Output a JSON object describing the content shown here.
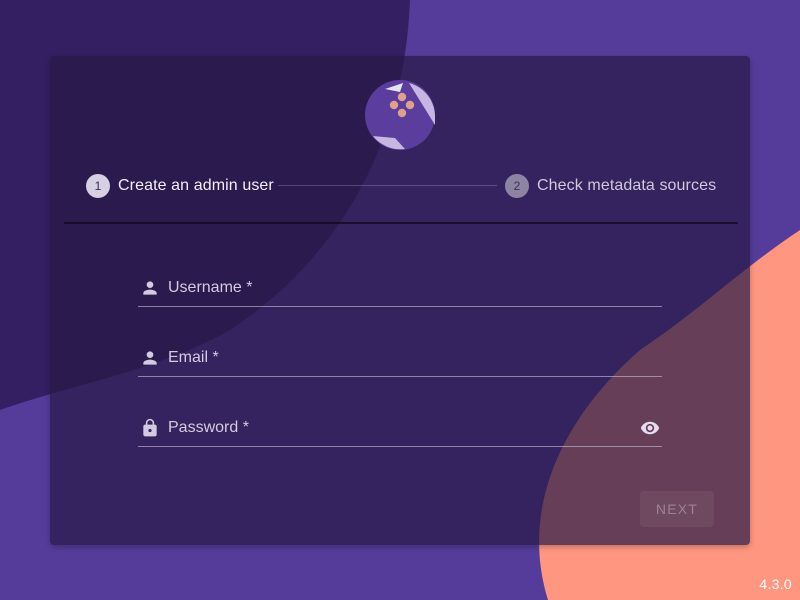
{
  "colors": {
    "background": "#553c9a",
    "dark_blob": "#341f63",
    "accent_blob": "#ff9680",
    "card": "#261846",
    "logo_dots": "#e0a08c"
  },
  "logo": {
    "icon": "app-logo-icon"
  },
  "stepper": {
    "steps": [
      {
        "number": "1",
        "label": "Create an admin user",
        "active": true
      },
      {
        "number": "2",
        "label": "Check metadata sources",
        "active": false
      }
    ]
  },
  "form": {
    "username": {
      "placeholder": "Username *",
      "value": "",
      "icon": "person-icon"
    },
    "email": {
      "placeholder": "Email *",
      "value": "",
      "icon": "person-icon"
    },
    "password": {
      "placeholder": "Password *",
      "value": "",
      "icon": "lock-icon",
      "toggle_icon": "eye-icon"
    }
  },
  "actions": {
    "next_label": "NEXT",
    "next_disabled": true
  },
  "footer": {
    "version": "4.3.0"
  }
}
